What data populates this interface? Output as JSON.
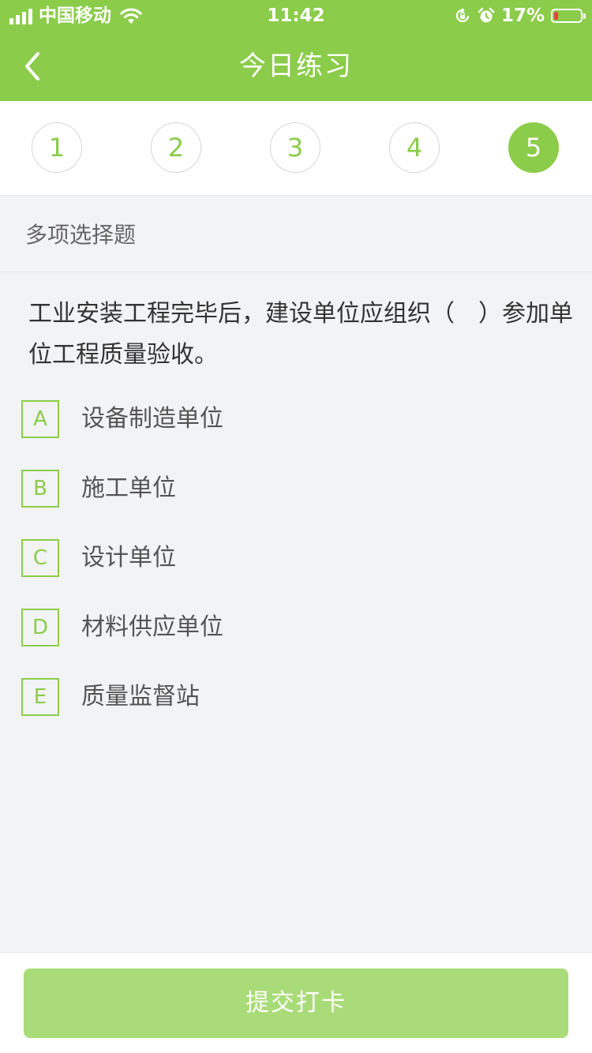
{
  "status_bar": {
    "carrier": "中国移动",
    "time": "11:42",
    "battery_percent": "17%",
    "battery_level": 0.17,
    "icons": [
      "signal-icon",
      "wifi-icon",
      "orientation-lock-icon",
      "alarm-icon",
      "battery-icon"
    ]
  },
  "nav": {
    "title": "今日练习",
    "back_icon": "chevron-left-icon"
  },
  "steps": {
    "items": [
      "1",
      "2",
      "3",
      "4",
      "5"
    ],
    "active": "5"
  },
  "question": {
    "type_label": "多项选择题",
    "text": "工业安装工程完毕后，建设单位应组织（　）参加单位工程质量验收。",
    "options": [
      {
        "letter": "A",
        "text": "设备制造单位"
      },
      {
        "letter": "B",
        "text": "施工单位"
      },
      {
        "letter": "C",
        "text": "设计单位"
      },
      {
        "letter": "D",
        "text": "材料供应单位"
      },
      {
        "letter": "E",
        "text": "质量监督站"
      }
    ]
  },
  "footer": {
    "submit_label": "提交打卡"
  },
  "colors": {
    "brand": "#8bcc4a",
    "button_disabled": "#a9dc78",
    "background": "#f2f3f5",
    "battery_low": "#e64340"
  }
}
